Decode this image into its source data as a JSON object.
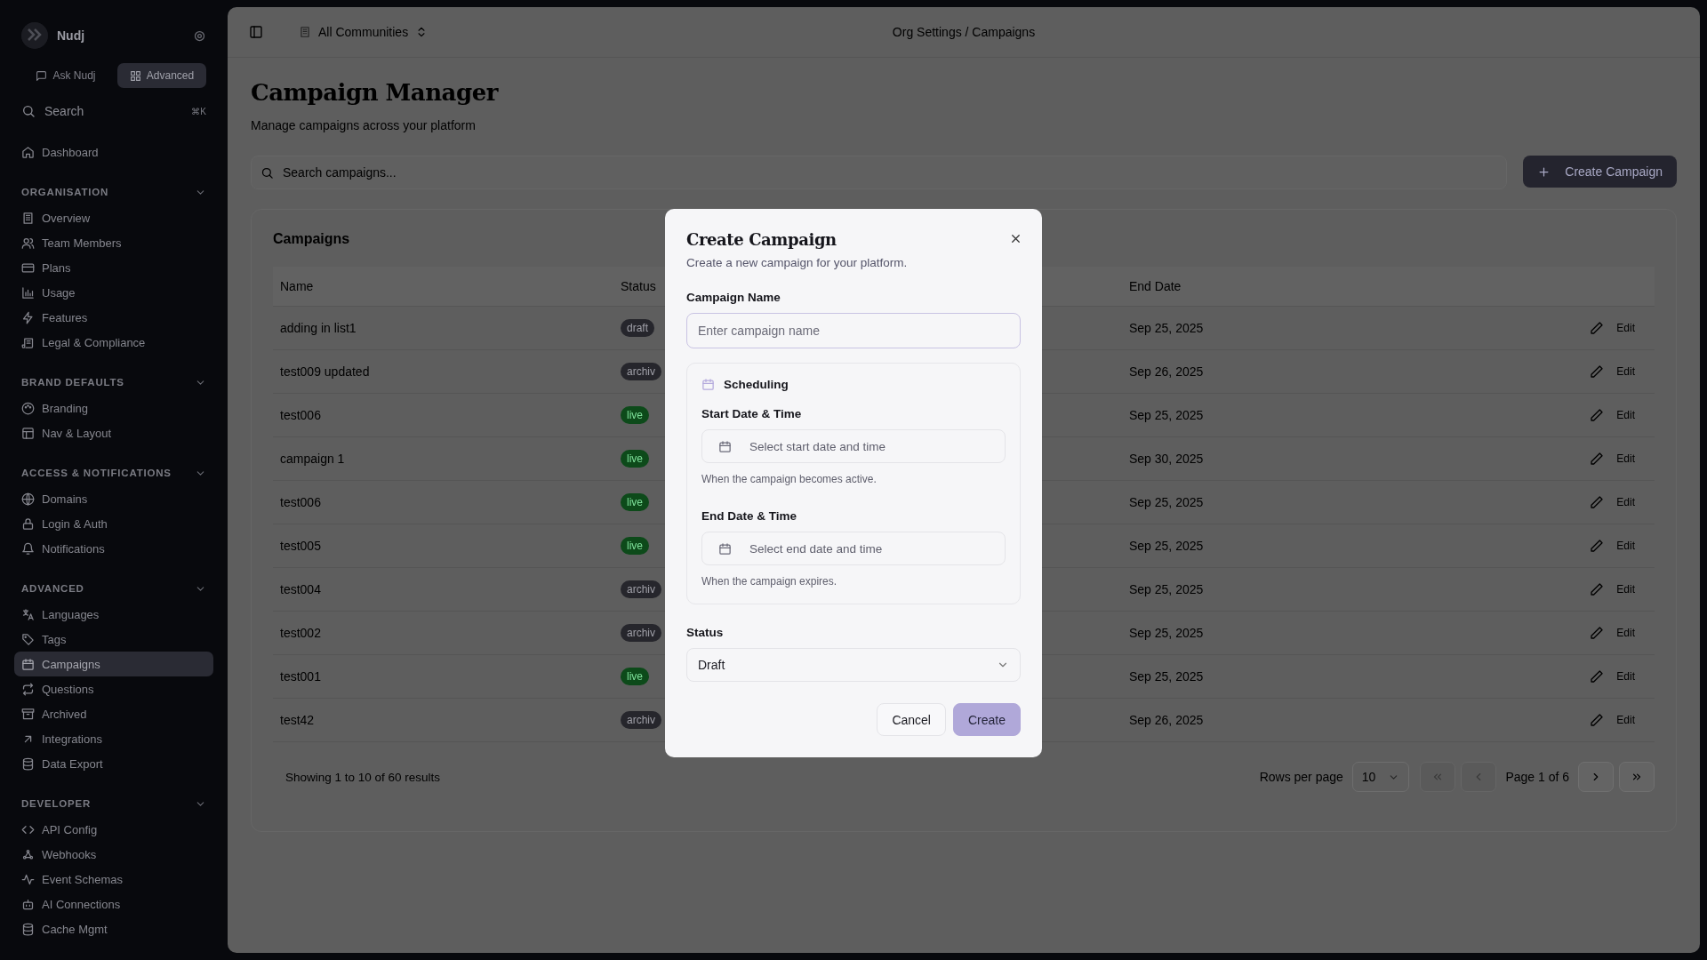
{
  "sidebar": {
    "brand": "Nudj",
    "modes": [
      {
        "label": "Ask Nudj",
        "selected": false
      },
      {
        "label": "Advanced",
        "selected": true
      }
    ],
    "search": {
      "placeholder": "Search",
      "shortcut": "⌘K"
    },
    "top_items": [
      {
        "label": "Dashboard",
        "selected": false
      }
    ],
    "sections": [
      {
        "title": "ORGANISATION",
        "expanded": true,
        "items": [
          {
            "label": "Overview",
            "selected": false
          },
          {
            "label": "Team Members",
            "selected": false
          },
          {
            "label": "Plans",
            "selected": false
          },
          {
            "label": "Usage",
            "selected": false
          },
          {
            "label": "Features",
            "selected": false
          },
          {
            "label": "Legal & Compliance",
            "selected": false
          }
        ]
      },
      {
        "title": "BRAND DEFAULTS",
        "expanded": true,
        "items": [
          {
            "label": "Branding",
            "selected": false
          },
          {
            "label": "Nav & Layout",
            "selected": false
          }
        ]
      },
      {
        "title": "ACCESS & NOTIFICATIONS",
        "expanded": true,
        "items": [
          {
            "label": "Domains",
            "selected": false
          },
          {
            "label": "Login & Auth",
            "selected": false
          },
          {
            "label": "Notifications",
            "selected": false
          }
        ]
      },
      {
        "title": "ADVANCED",
        "expanded": true,
        "items": [
          {
            "label": "Languages",
            "selected": false
          },
          {
            "label": "Tags",
            "selected": false
          },
          {
            "label": "Campaigns",
            "selected": true
          },
          {
            "label": "Questions",
            "selected": false
          },
          {
            "label": "Archived",
            "selected": false
          },
          {
            "label": "Integrations",
            "selected": false
          },
          {
            "label": "Data Export",
            "selected": false
          }
        ]
      },
      {
        "title": "DEVELOPER",
        "expanded": true,
        "items": [
          {
            "label": "API Config",
            "selected": false
          },
          {
            "label": "Webhooks",
            "selected": false
          },
          {
            "label": "Event Schemas",
            "selected": false
          },
          {
            "label": "AI Connections",
            "selected": false
          },
          {
            "label": "Cache Mgmt",
            "selected": false
          }
        ]
      }
    ]
  },
  "header": {
    "community": "All Communities",
    "breadcrumb": "Org Settings / Campaigns"
  },
  "page": {
    "title": "Campaign Manager",
    "subtitle": "Manage campaigns across your platform",
    "search": {
      "placeholder": "Search campaigns..."
    },
    "create_button": "Create Campaign"
  },
  "table": {
    "title": "Campaigns",
    "columns": [
      "Name",
      "Status",
      "End Date"
    ],
    "rows": [
      {
        "name": "adding in list1",
        "status": {
          "label": "draft",
          "kind": "draft"
        },
        "end_date": "Sep 25, 2025",
        "action": "Edit"
      },
      {
        "name": "test009 updated",
        "status": {
          "label": "archiv",
          "kind": "archived"
        },
        "end_date": "Sep 26, 2025",
        "action": "Edit"
      },
      {
        "name": "test006",
        "status": {
          "label": "live",
          "kind": "live"
        },
        "end_date": "Sep 25, 2025",
        "action": "Edit"
      },
      {
        "name": "campaign 1",
        "status": {
          "label": "live",
          "kind": "live"
        },
        "end_date": "Sep 30, 2025",
        "action": "Edit"
      },
      {
        "name": "test006",
        "status": {
          "label": "live",
          "kind": "live"
        },
        "end_date": "Sep 25, 2025",
        "action": "Edit"
      },
      {
        "name": "test005",
        "status": {
          "label": "live",
          "kind": "live"
        },
        "end_date": "Sep 25, 2025",
        "action": "Edit"
      },
      {
        "name": "test004",
        "status": {
          "label": "archiv",
          "kind": "archived"
        },
        "end_date": "Sep 25, 2025",
        "action": "Edit"
      },
      {
        "name": "test002",
        "status": {
          "label": "archiv",
          "kind": "archived"
        },
        "end_date": "Sep 25, 2025",
        "action": "Edit"
      },
      {
        "name": "test001",
        "status": {
          "label": "live",
          "kind": "live"
        },
        "end_date": "Sep 25, 2025",
        "action": "Edit"
      },
      {
        "name": "test42",
        "status": {
          "label": "archiv",
          "kind": "archived"
        },
        "end_date": "Sep 26, 2025",
        "action": "Edit"
      }
    ],
    "footer": {
      "summary": "Showing 1 to 10 of 60 results",
      "rows_per_page_label": "Rows per page",
      "rows_per_page": "10",
      "page": "Page 1 of 6",
      "nav": [
        {
          "kind": "first",
          "disabled": true
        },
        {
          "kind": "prev",
          "disabled": true
        },
        {
          "kind": "page"
        },
        {
          "kind": "next",
          "disabled": false
        },
        {
          "kind": "last",
          "disabled": false
        }
      ]
    }
  },
  "modal": {
    "title": "Create Campaign",
    "subtitle": "Create a new campaign for your platform.",
    "name_label": "Campaign Name",
    "name_placeholder": "Enter campaign name",
    "scheduling": {
      "title": "Scheduling",
      "start": {
        "label": "Start Date & Time",
        "placeholder": "Select start date and time",
        "hint": "When the campaign becomes active."
      },
      "end": {
        "label": "End Date & Time",
        "placeholder": "Select end date and time",
        "hint": "When the campaign expires."
      }
    },
    "status": {
      "label": "Status",
      "value": "Draft"
    },
    "buttons": {
      "cancel": "Cancel",
      "create": "Create"
    }
  }
}
